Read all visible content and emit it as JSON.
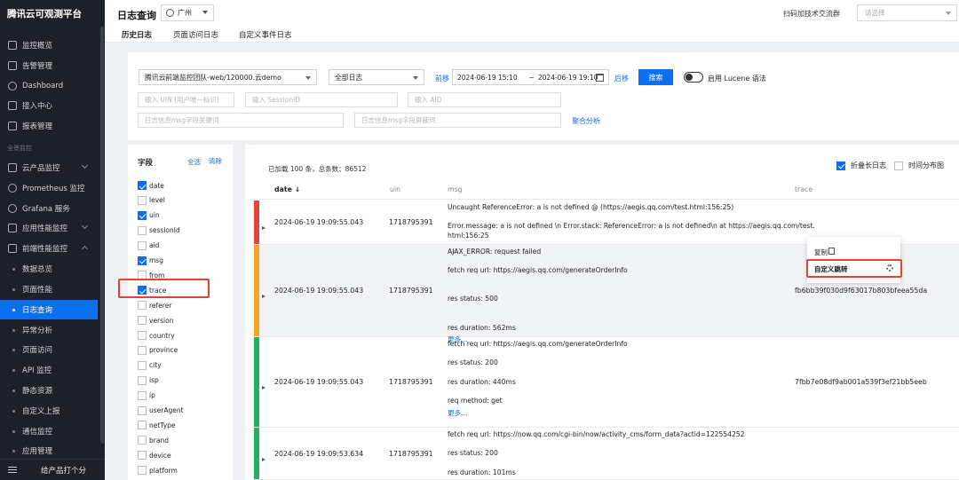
{
  "sidebar": {
    "title": "腾讯云可观测平台",
    "items": [
      {
        "label": "监控概览",
        "icon": "grid-icon"
      },
      {
        "label": "告警管理",
        "icon": "alarm-icon"
      },
      {
        "label": "Dashboard",
        "icon": "dashboard-icon"
      },
      {
        "label": "接入中心",
        "icon": "access-icon"
      },
      {
        "label": "报表管理",
        "icon": "report-icon"
      }
    ],
    "section_label": "全景监控",
    "groups": [
      {
        "label": "云产品监控",
        "icon": "cloud-icon"
      },
      {
        "label": "Prometheus 监控",
        "icon": "prometheus-icon"
      },
      {
        "label": "Grafana 服务",
        "icon": "grafana-icon"
      },
      {
        "label": "应用性能监控",
        "icon": "apm-icon"
      },
      {
        "label": "前端性能监控",
        "icon": "frontend-icon"
      }
    ],
    "sub_items": [
      {
        "label": "数据总览",
        "active": false
      },
      {
        "label": "页面性能",
        "active": false
      },
      {
        "label": "日志查询",
        "active": true
      },
      {
        "label": "异常分析",
        "active": false
      },
      {
        "label": "页面访问",
        "active": false
      },
      {
        "label": "API 监控",
        "active": false
      },
      {
        "label": "静态资源",
        "active": false
      },
      {
        "label": "自定义上报",
        "active": false
      },
      {
        "label": "通信监控",
        "active": false
      },
      {
        "label": "应用管理",
        "active": false
      }
    ],
    "footer": "给产品打个分"
  },
  "header": {
    "title": "日志查询",
    "region": "广州",
    "scan_text": "扫码加技术交流群",
    "select_placeholder": "请选择"
  },
  "tabs": [
    {
      "label": "历史日志",
      "active": true
    },
    {
      "label": "页面访问日志",
      "active": false
    },
    {
      "label": "自定义事件日志",
      "active": false
    }
  ],
  "filter": {
    "project": "腾讯云前端监控团队-web/120000.云demo",
    "log_type": "全部日志",
    "prev": "前移",
    "next": "后移",
    "date_start": "2024-06-19 15:10",
    "date_sep": "~",
    "date_end": "2024-06-19 19:10",
    "search_button": "搜索",
    "lucene_label": "启用 Lucene 语法",
    "uin_placeholder": "输入 UIN (用户唯一标识)",
    "session_placeholder": "输入 SessionID",
    "aid_placeholder": "输入 AID",
    "include_placeholder": "日志信息msg字段关键词",
    "exclude_placeholder": "日志信息msg字段屏蔽词",
    "aggregate_link": "聚合分析"
  },
  "fields": {
    "title": "字段",
    "select_all": "全选",
    "clear": "清除",
    "items": [
      {
        "name": "date",
        "checked": true
      },
      {
        "name": "level",
        "checked": false
      },
      {
        "name": "uin",
        "checked": true
      },
      {
        "name": "sessionId",
        "checked": false
      },
      {
        "name": "aid",
        "checked": false
      },
      {
        "name": "msg",
        "checked": true
      },
      {
        "name": "from",
        "checked": false
      },
      {
        "name": "trace",
        "checked": true
      },
      {
        "name": "referer",
        "checked": false
      },
      {
        "name": "version",
        "checked": false
      },
      {
        "name": "country",
        "checked": false
      },
      {
        "name": "province",
        "checked": false
      },
      {
        "name": "city",
        "checked": false
      },
      {
        "name": "isp",
        "checked": false
      },
      {
        "name": "ip",
        "checked": false
      },
      {
        "name": "userAgent",
        "checked": false
      },
      {
        "name": "netType",
        "checked": false
      },
      {
        "name": "brand",
        "checked": false
      },
      {
        "name": "device",
        "checked": false
      },
      {
        "name": "platform",
        "checked": false
      }
    ]
  },
  "results": {
    "loaded_text": "已加载 100 条，总条数：86512",
    "fold_label": "折叠长日志",
    "fold_checked": true,
    "distribution_label": "时间分布图",
    "distribution_checked": false,
    "columns": {
      "date": "date",
      "date_sort": "↓",
      "uin": "uin",
      "msg": "msg",
      "trace": "trace"
    },
    "rows": [
      {
        "level_color": "#e2453b",
        "date": "2024-06-19 19:09:55.043",
        "uin": "1718795391",
        "msg": [
          "Uncaught ReferenceError: a is not defined @ (https://aegis.qq.com/test.html:156:25)",
          "",
          "Error.message: a is not defined \\n  Error.stack: ReferenceError: a is not defined\\n    at https://aegis.qq.com/test.",
          "html:156:25"
        ],
        "more": "",
        "trace": ""
      },
      {
        "level_color": "#f5a623",
        "date": "2024-06-19 19:09:55.043",
        "uin": "1718795391",
        "msg": [
          "AJAX_ERROR: request failed",
          "",
          "fetch req url: https://aegis.qq.com/generateOrderInfo",
          "",
          "",
          "res status: 500",
          "",
          "",
          "res duration: 562ms"
        ],
        "more": "更多...",
        "trace": "fb6bb39f030d9f63017b803bfeea55da"
      },
      {
        "level_color": "#27ae60",
        "date": "2024-06-19 19:09:55.043",
        "uin": "1718795391",
        "msg": [
          "fetch req url: https://aegis.qq.com/generateOrderInfo",
          "",
          "res status: 200",
          "",
          "res duration: 440ms",
          "",
          "req method: get"
        ],
        "more": "更多...",
        "trace": "7fbb7e08df9ab001a539f3ef21bb5eeb"
      },
      {
        "level_color": "#27ae60",
        "date": "2024-06-19 19:09:53.634",
        "uin": "1718795391",
        "msg": [
          "fetch req url: https://now.qq.com/cgi-bin/now/activity_cms/form_data?actid=122554252",
          "",
          "res status: 200",
          "",
          "res duration: 101ms"
        ],
        "more": "",
        "trace": ""
      }
    ]
  },
  "context_menu": {
    "copy": "复制",
    "custom_jump": "自定义跳转"
  }
}
